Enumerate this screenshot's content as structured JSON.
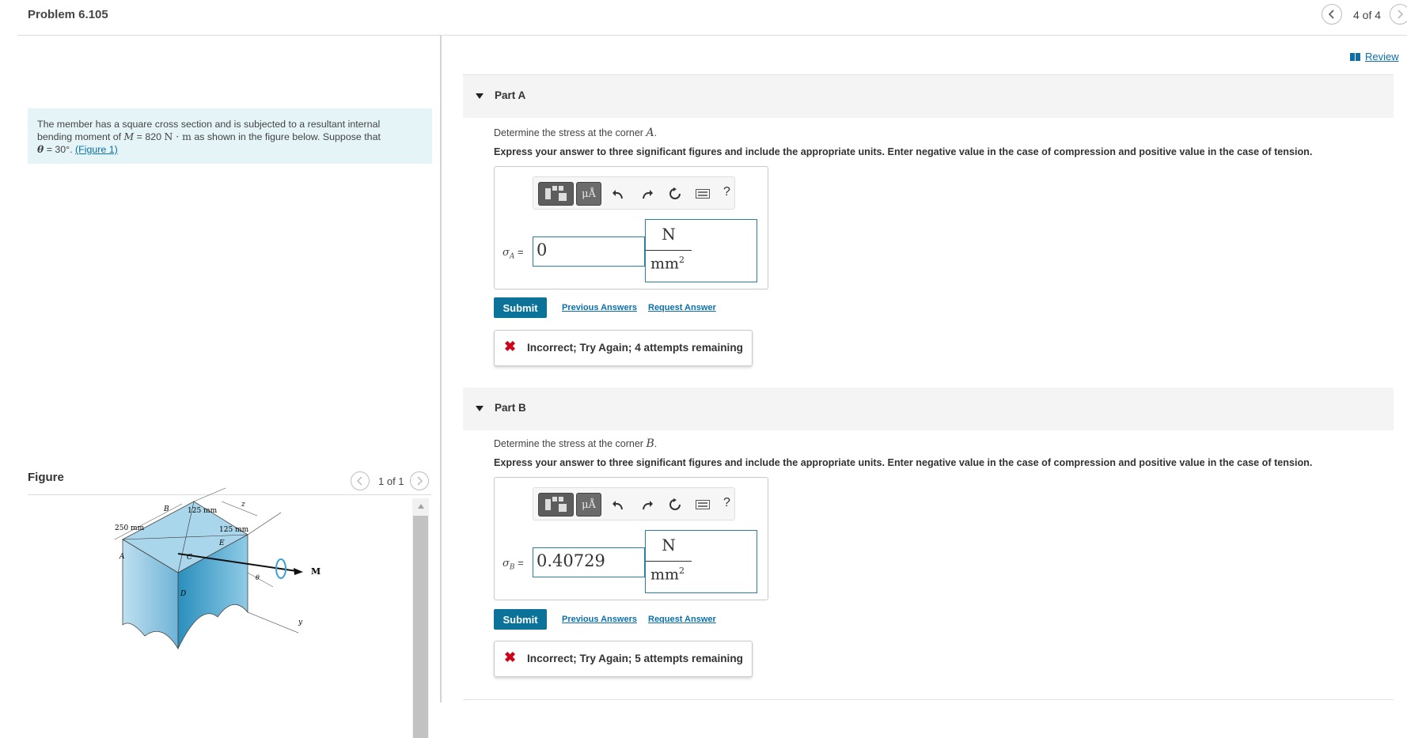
{
  "header": {
    "title": "Problem 6.105",
    "pager": "4 of 4"
  },
  "problem": {
    "text_1": "The member has a square cross section and is subjected to a resultant internal",
    "text_2a": "bending moment of ",
    "var_M": "M",
    "text_2b": " = 820 ",
    "unit_Nm": "N · m",
    "text_2c": " as shown in the figure below. Suppose that",
    "var_theta": "θ",
    "text_3a": " = 30°. ",
    "figure_link": "(Figure 1)"
  },
  "figure": {
    "title": "Figure",
    "pager": "1 of 1",
    "labels": {
      "B": "B",
      "dim_125_top": "125 mm",
      "z": "z",
      "dim_250": "250 mm",
      "dim_125_right": "125 mm",
      "E": "E",
      "A": "A",
      "C": "C",
      "M": "M",
      "theta": "θ",
      "D": "D",
      "y": "y"
    }
  },
  "review": {
    "label": "Review",
    "icon": "book-icon"
  },
  "toolbar": {
    "mu_label": "μÅ",
    "help_label": "?",
    "icons": [
      "templates-icon",
      "units-icon",
      "undo-icon",
      "redo-icon",
      "reset-icon",
      "keyboard-icon",
      "help-icon"
    ]
  },
  "parts": [
    {
      "label": "Part A",
      "question_prefix": "Determine the stress at the corner ",
      "question_var": "A",
      "question_suffix": ".",
      "instruction": "Express your answer to three significant figures and include the appropriate units. Enter negative value in the case of compression and positive value in the case of tension.",
      "var_symbol": "σ",
      "var_sub": "A",
      "eq": " =",
      "value": "0",
      "unit_num": "N",
      "unit_den": "mm",
      "unit_exp": "2",
      "submit_label": "Submit",
      "prev_answers_label": "Previous Answers",
      "request_answer_label": "Request Answer",
      "feedback": "Incorrect; Try Again; 4 attempts remaining"
    },
    {
      "label": "Part B",
      "question_prefix": "Determine the stress at the corner ",
      "question_var": "B",
      "question_suffix": ".",
      "instruction": "Express your answer to three significant figures and include the appropriate units. Enter negative value in the case of compression and positive value in the case of tension.",
      "var_symbol": "σ",
      "var_sub": "B",
      "eq": " =",
      "value": "0.40729",
      "unit_num": "N",
      "unit_den": "mm",
      "unit_exp": "2",
      "submit_label": "Submit",
      "prev_answers_label": "Previous Answers",
      "request_answer_label": "Request Answer",
      "feedback": "Incorrect; Try Again; 5 attempts remaining"
    }
  ],
  "colors": {
    "accent": "#0b7399",
    "link": "#0d6fa8",
    "error": "#d0021b",
    "problem_bg": "#e5f4f6"
  }
}
